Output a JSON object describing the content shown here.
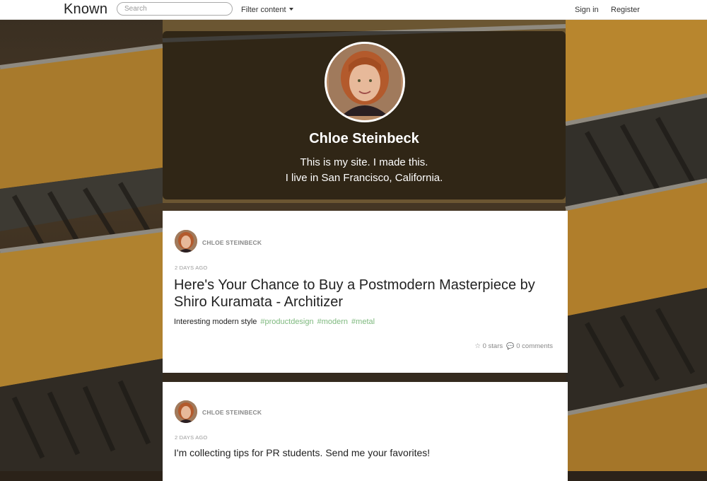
{
  "navbar": {
    "brand": "Known",
    "search_placeholder": "Search",
    "filter_label": "Filter content",
    "sign_in": "Sign in",
    "register": "Register"
  },
  "profile": {
    "name": "Chloe Steinbeck",
    "bio_line1": "This is my site. I made this.",
    "bio_line2": "I live in San Francisco, California."
  },
  "posts": [
    {
      "author": "CHLOE STEINBECK",
      "date": "2 DAYS AGO",
      "title": "Here's Your Chance to Buy a Postmodern Masterpiece by Shiro Kuramata - Architizer",
      "description": "Interesting modern style",
      "tags": [
        "#productdesign",
        "#modern",
        "#metal"
      ],
      "stars": "0 stars",
      "comments": "0 comments"
    },
    {
      "author": "CHLOE STEINBECK",
      "date": "2 DAYS AGO",
      "text": "I'm collecting tips for PR students. Send me your favorites!"
    }
  ],
  "colors": {
    "tag": "#7fb97f",
    "profile_overlay": "rgba(0,0,0,0.55)",
    "boat_wood": "#b8862e"
  }
}
